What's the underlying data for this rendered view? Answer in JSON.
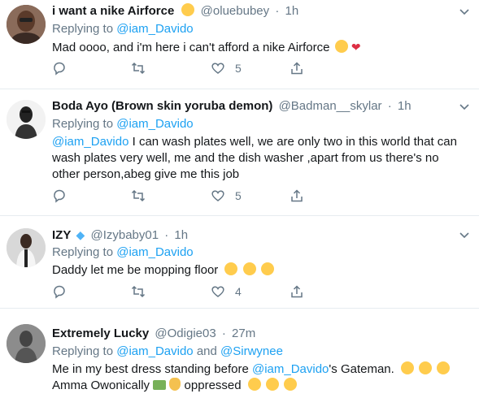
{
  "tweets": [
    {
      "name": "i want a nike Airforce",
      "handle": "@oluebubey",
      "dot": "·",
      "time": "1h",
      "replying_prefix": "Replying to",
      "replying_to": "@iam_Davido",
      "text": "Mad oooo, and i'm here i can't afford a nike Airforce",
      "likes": "5"
    },
    {
      "name": "Boda Ayo (Brown skin yoruba demon)",
      "handle": "@Badman__skylar",
      "dot": "·",
      "time": "1h",
      "replying_prefix": "Replying to",
      "replying_to": "@iam_Davido",
      "text_mention": "@iam_Davido",
      "text": " I can wash plates well, we are only two in this world that can wash plates very well, me and the dish washer ,apart from us there's no other person,abeg give me this job",
      "likes": "5"
    },
    {
      "name": "IZY",
      "handle": "@Izybaby01",
      "dot": "·",
      "time": "1h",
      "replying_prefix": "Replying to",
      "replying_to": "@iam_Davido",
      "text": "Daddy let me be mopping floor",
      "likes": "4"
    },
    {
      "name": "Extremely Lucky",
      "handle": "@Odigie03",
      "dot": "·",
      "time": "27m",
      "replying_prefix": "Replying to",
      "replying_to": "@iam_Davido",
      "replying_and": "and",
      "replying_to_2": "@Sirwynee",
      "text_a": "Me in my best dress standing before ",
      "text_mention": "@iam_Davido",
      "text_b": "'s Gateman.",
      "text_line2": "Amma Owonically",
      "text_line2b": " oppressed"
    }
  ],
  "colors": {
    "link": "#1da1f2",
    "muted": "#657786",
    "name": "#14171a",
    "divider": "#e6ecf0"
  }
}
